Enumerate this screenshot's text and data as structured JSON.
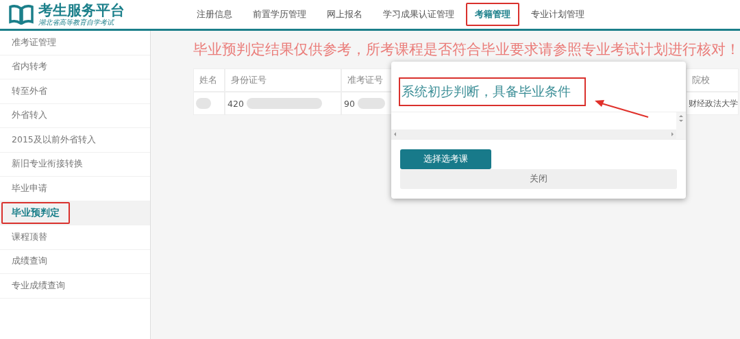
{
  "header": {
    "logo_title": "考生服务平台",
    "logo_subtitle": "湖北省高等教育自学考试",
    "nav": [
      {
        "label": "注册信息",
        "selected": false
      },
      {
        "label": "前置学历管理",
        "selected": false
      },
      {
        "label": "网上报名",
        "selected": false
      },
      {
        "label": "学习成果认证管理",
        "selected": false
      },
      {
        "label": "考籍管理",
        "selected": true
      },
      {
        "label": "专业计划管理",
        "selected": false
      }
    ]
  },
  "sidebar": {
    "items": [
      {
        "label": "准考证管理",
        "selected": false
      },
      {
        "label": "省内转考",
        "selected": false
      },
      {
        "label": "转至外省",
        "selected": false
      },
      {
        "label": "外省转入",
        "selected": false
      },
      {
        "label": "2015及以前外省转入",
        "selected": false
      },
      {
        "label": "新旧专业衔接转换",
        "selected": false
      },
      {
        "label": "毕业申请",
        "selected": false
      },
      {
        "label": "毕业预判定",
        "selected": true
      },
      {
        "label": "课程顶替",
        "selected": false
      },
      {
        "label": "成绩查询",
        "selected": false
      },
      {
        "label": "专业成绩查询",
        "selected": false
      }
    ]
  },
  "notice": "毕业预判定结果仅供参考，所考课程是否符合毕业要求请参照专业考试计划进行核对！",
  "table": {
    "columns": [
      "姓名",
      "身份证号",
      "准考证号",
      "院校"
    ],
    "rows": [
      {
        "id_number": "420",
        "exam_number": "90",
        "school": "财经政法大学"
      }
    ]
  },
  "dialog": {
    "message": "系统初步判断，具备毕业条件",
    "buttons": [
      {
        "label": "选择选考课",
        "kind": "primary"
      },
      {
        "label": "关闭",
        "kind": "secondary"
      }
    ]
  }
}
